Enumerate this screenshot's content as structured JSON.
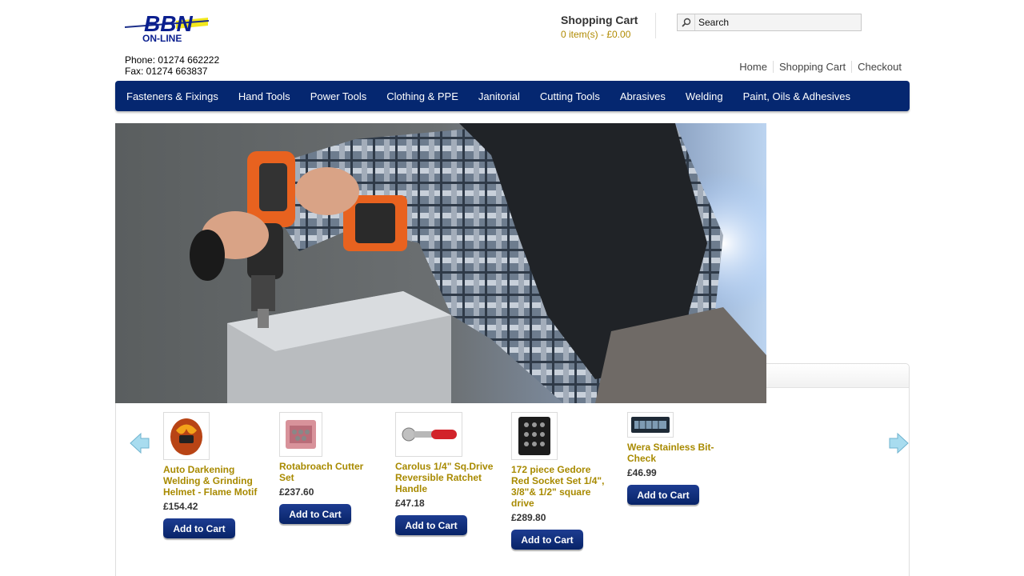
{
  "header": {
    "logo_text_top": "BBN",
    "logo_text_bottom": "ON-LINE",
    "phone": "Phone: 01274 662222",
    "fax": "Fax: 01274 663837"
  },
  "cart": {
    "title": "Shopping Cart",
    "summary": "0 item(s) - £0.00"
  },
  "search": {
    "placeholder": "Search"
  },
  "top_links": [
    "Home",
    "Shopping Cart",
    "Checkout"
  ],
  "nav": {
    "items": [
      "Fasteners & Fixings",
      "Hand Tools",
      "Power Tools",
      "Clothing & PPE",
      "Janitorial",
      "Cutting Tools",
      "Abrasives",
      "Welding",
      "Paint, Oils & Adhesives"
    ]
  },
  "products": [
    {
      "name": "Auto Darkening Welding & Grinding Helmet - Flame Motif",
      "price": "£154.42",
      "button": "Add to Cart"
    },
    {
      "name": "Rotabroach Cutter Set",
      "price": "£237.60",
      "button": "Add to Cart"
    },
    {
      "name": "Carolus 1/4\" Sq.Drive Reversible Ratchet Handle",
      "price": "£47.18",
      "button": "Add to Cart"
    },
    {
      "name": "172 piece Gedore Red Socket Set 1/4\", 3/8\"& 1/2\" square drive",
      "price": "£289.80",
      "button": "Add to Cart"
    },
    {
      "name": "Wera Stainless Bit-Check",
      "price": "£46.99",
      "button": "Add to Cart"
    }
  ],
  "colors": {
    "nav_bg": "#052770",
    "product_name": "#a88a00",
    "cart_summary": "#b08a00",
    "button_bg": "#082468"
  }
}
